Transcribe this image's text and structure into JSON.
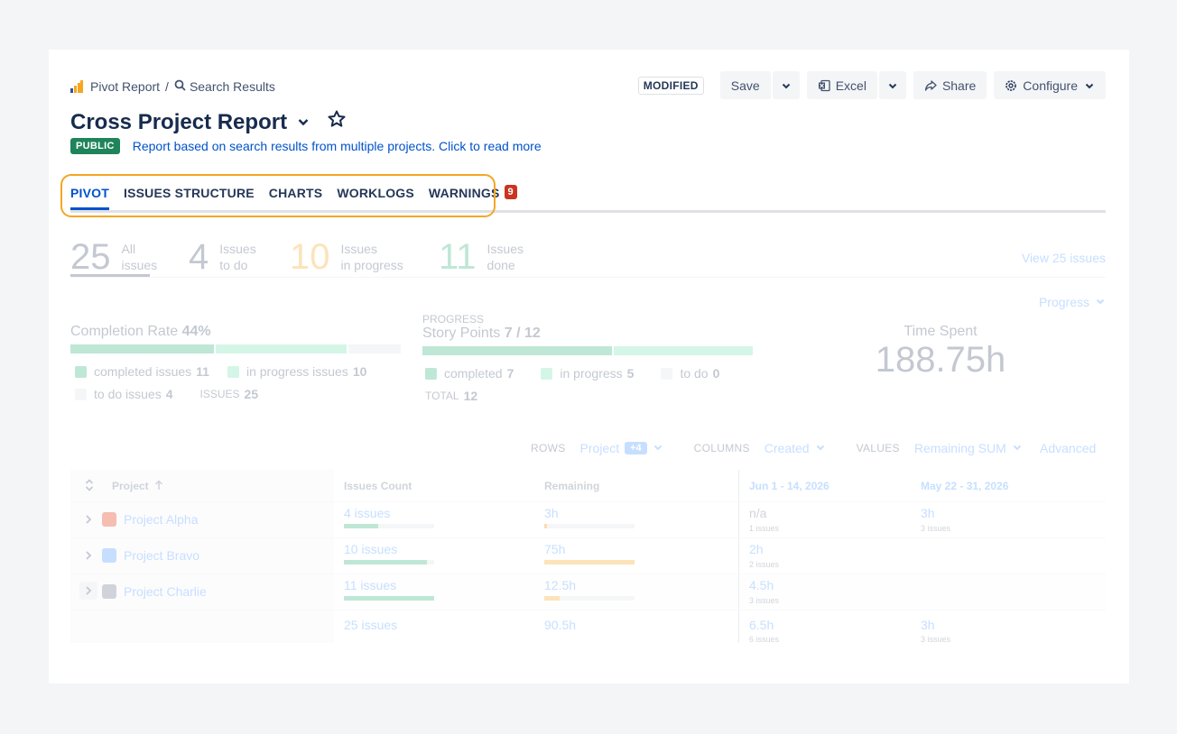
{
  "breadcrumb": {
    "root": "Pivot Report",
    "separator": "/",
    "current": "Search Results"
  },
  "header": {
    "modified_badge": "MODIFIED",
    "save_label": "Save",
    "excel_label": "Excel",
    "share_label": "Share",
    "configure_label": "Configure"
  },
  "report": {
    "title": "Cross Project Report",
    "visibility": "PUBLIC",
    "description": "Report based on search results from multiple projects. Click to read more"
  },
  "tabs": [
    {
      "label": "PIVOT",
      "active": true
    },
    {
      "label": "ISSUES STRUCTURE"
    },
    {
      "label": "CHARTS"
    },
    {
      "label": "WORKLOGS"
    },
    {
      "label": "WARNINGS",
      "count": "9"
    }
  ],
  "stats": [
    {
      "value": "25",
      "line1": "All",
      "line2": "issues",
      "color": "#42526e"
    },
    {
      "value": "4",
      "line1": "Issues",
      "line2": "to do",
      "color": "#42526e"
    },
    {
      "value": "10",
      "line1": "Issues",
      "line2": "in progress",
      "color": "#f5a623"
    },
    {
      "value": "11",
      "line1": "Issues",
      "line2": "done",
      "color": "#36b37e"
    }
  ],
  "view_issues_link": "View 25 issues",
  "progress_dropdown": "Progress",
  "completion": {
    "label": "Completion Rate",
    "rate": "44%",
    "completed": {
      "label": "completed issues",
      "value": "11"
    },
    "in_progress": {
      "label": "in progress issues",
      "value": "10"
    },
    "todo": {
      "label": "to do issues",
      "value": "4"
    },
    "total": {
      "label": "ISSUES",
      "value": "25"
    }
  },
  "story_points": {
    "caption": "PROGRESS",
    "label": "Story Points",
    "value": "7 / 12",
    "completed": {
      "label": "completed",
      "value": "7"
    },
    "in_progress": {
      "label": "in progress",
      "value": "5"
    },
    "todo": {
      "label": "to do",
      "value": "0"
    },
    "total": {
      "label": "TOTAL",
      "value": "12"
    }
  },
  "time_spent": {
    "label": "Time Spent",
    "value": "188.75h"
  },
  "pivot_config": {
    "rows_label": "ROWS",
    "rows_value": "Project",
    "rows_extra": "+4",
    "columns_label": "COLUMNS",
    "columns_value": "Created",
    "values_label": "VALUES",
    "values_value": "Remaining SUM",
    "advanced": "Advanced"
  },
  "table": {
    "headers": {
      "project": "Project",
      "count": "Issues Count",
      "remaining": "Remaining",
      "date1": "Jun 1 - 14, 2026",
      "date2": "May 22 - 31, 2026"
    },
    "rows": [
      {
        "name": "Project Alpha",
        "count": "4 issues",
        "remaining": "3h",
        "d1": "n/a",
        "d1_sub": "1 issues",
        "d2": "3h",
        "d2_sub": "3 issues",
        "count_fill": 0.38,
        "rem_fill": 0.03,
        "rem_color": "#ff8b00",
        "icon_color": "#de350b"
      },
      {
        "name": "Project Bravo",
        "count": "10 issues",
        "remaining": "75h",
        "d1": "2h",
        "d1_sub": "2 issues",
        "d2": "",
        "d2_sub": "",
        "count_fill": 0.92,
        "rem_fill": 1.0,
        "rem_color": "#f5a623",
        "icon_color": "#4c9aff"
      },
      {
        "name": "Project Charlie",
        "count": "11 issues",
        "remaining": "12.5h",
        "d1": "4.5h",
        "d1_sub": "3 issues",
        "d2": "",
        "d2_sub": "",
        "count_fill": 1.0,
        "rem_fill": 0.17,
        "rem_color": "#f5a623",
        "icon_color": "#6b778c"
      }
    ],
    "totals": {
      "count": "25 issues",
      "remaining": "90.5h",
      "d1": "6.5h",
      "d1_sub": "6 issues",
      "d2": "3h",
      "d2_sub": "3 issues"
    }
  }
}
